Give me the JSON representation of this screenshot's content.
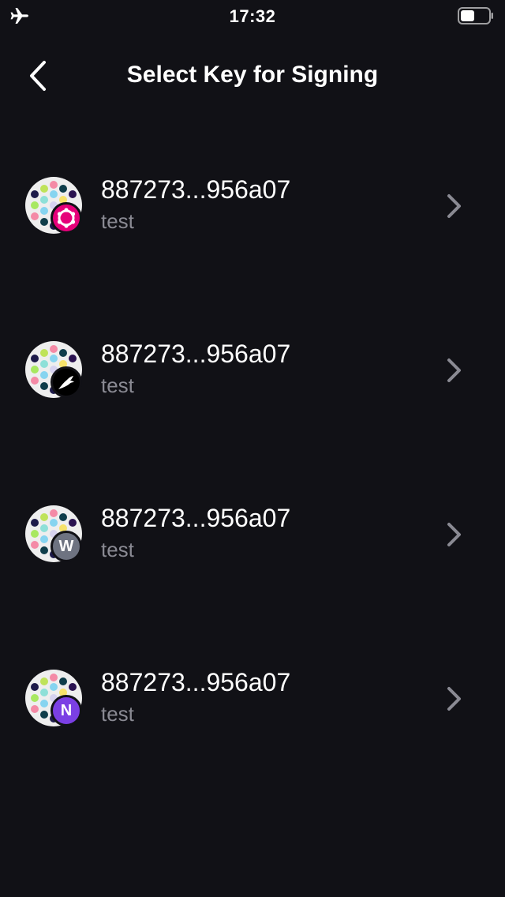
{
  "status_bar": {
    "time": "17:32",
    "airplane_icon": "airplane-icon",
    "battery_icon": "battery-icon"
  },
  "header": {
    "title": "Select Key for Signing",
    "back_icon": "chevron-left-icon"
  },
  "keys": [
    {
      "address": "887273...956a07",
      "name": "test",
      "network_badge": "polkadot-icon",
      "badge_color": "#e6007a",
      "badge_letter": ""
    },
    {
      "address": "887273...956a07",
      "name": "test",
      "network_badge": "kusama-icon",
      "badge_color": "#000000",
      "badge_letter": ""
    },
    {
      "address": "887273...956a07",
      "name": "test",
      "network_badge": "westend-icon",
      "badge_color": "#6e7381",
      "badge_letter": "W"
    },
    {
      "address": "887273...956a07",
      "name": "test",
      "network_badge": "network-n-icon",
      "badge_color": "#7b3fe4",
      "badge_letter": "N"
    }
  ],
  "colors": {
    "background": "#111116",
    "secondary_text": "#8a8a93",
    "chevron": "#8a8a93"
  }
}
